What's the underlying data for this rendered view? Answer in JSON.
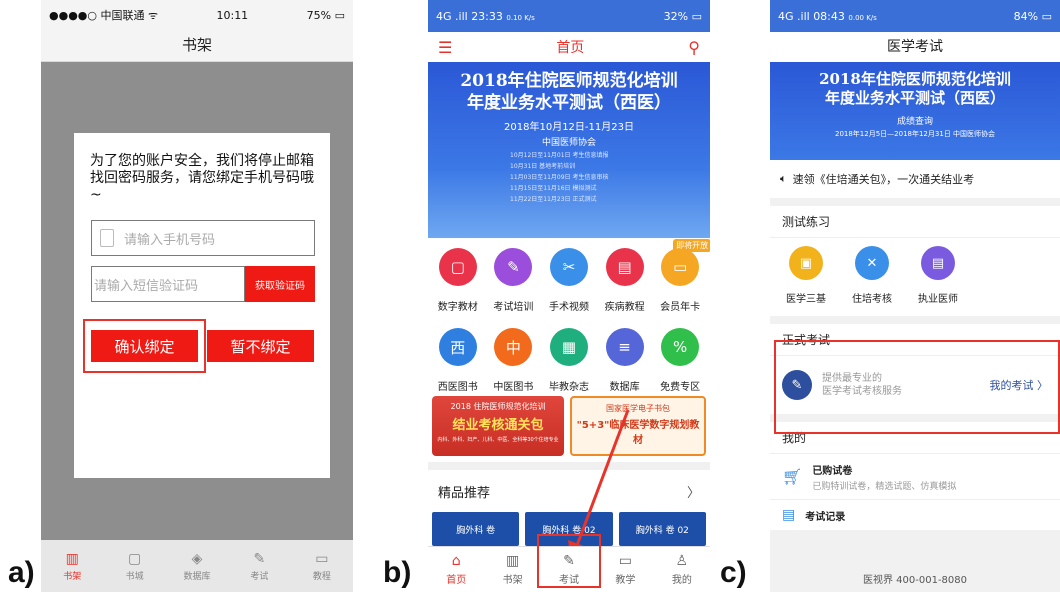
{
  "panel_labels": {
    "a": "a)",
    "b": "b)",
    "c": "c)"
  },
  "panel_a": {
    "status": {
      "carrier": "●●●●○ 中国联通 ᯤ",
      "time": "10:11",
      "battery": "75%"
    },
    "title": "书架",
    "dialog": {
      "message": "为了您的账户安全，我们将停止邮箱找回密码服务，请您绑定手机号码哦~",
      "phone_placeholder": "请输入手机号码",
      "sms_placeholder": "请输入短信验证码",
      "get_code_label": "获取验证码",
      "confirm_label": "确认绑定",
      "skip_label": "暂不绑定"
    },
    "tabs": [
      {
        "label": "书架",
        "icon": "bookshelf-icon"
      },
      {
        "label": "书城",
        "icon": "store-icon"
      },
      {
        "label": "数据库",
        "icon": "layers-icon"
      },
      {
        "label": "考试",
        "icon": "exam-icon"
      },
      {
        "label": "教程",
        "icon": "video-icon"
      }
    ]
  },
  "panel_b": {
    "status": {
      "network": "4G .ill",
      "time": "23:33",
      "speed": "0.10 K/s",
      "battery": "32%"
    },
    "title": "首页",
    "banner": {
      "title_line1": "2018年住院医师规范化培训",
      "title_line2": "年度业务水平测试（西医）",
      "dates": "2018年10月12日-11月23日",
      "org": "中国医师协会",
      "schedule": [
        "10月12日至11月01日  考生信息填报",
        "10月31日  基地考前培训",
        "11月03日至11月09日  考生信息审核",
        "11月15日至11月16日  模拟测试",
        "11月22日至11月23日  正式测试"
      ]
    },
    "grid": [
      {
        "label": "数字教材",
        "color": "#e8334a",
        "glyph": "▢"
      },
      {
        "label": "考试培训",
        "color": "#9b4ddb",
        "glyph": "✎"
      },
      {
        "label": "手术视频",
        "color": "#3a8fe8",
        "glyph": "✂"
      },
      {
        "label": "疾病教程",
        "color": "#e8334a",
        "glyph": "▤"
      },
      {
        "label": "会员年卡",
        "color": "#f5a623",
        "glyph": "▭"
      },
      {
        "label": "西医图书",
        "color": "#2f7fe0",
        "glyph": "西"
      },
      {
        "label": "中医图书",
        "color": "#f26a1b",
        "glyph": "中"
      },
      {
        "label": "毕教杂志",
        "color": "#1fae7d",
        "glyph": "▦"
      },
      {
        "label": "数据库",
        "color": "#5566d8",
        "glyph": "≡"
      },
      {
        "label": "免费专区",
        "color": "#2fbf4a",
        "glyph": "%"
      }
    ],
    "soon_badge": "即将开放",
    "promo1": {
      "line1": "2018 住院医师规范化培训",
      "line2": "结业考核通关包",
      "line3": "内科、外科、妇产、儿科、中医、全科等30个住培专业"
    },
    "promo2": {
      "line1": "国家医学电子书包",
      "line2": "\"5+3\"临床医学数字规划教材"
    },
    "section_title": "精品推荐",
    "thumbs": [
      "胸外科 卷",
      "胸外科 卷 02",
      "胸外科 卷 02"
    ],
    "tabs": [
      {
        "label": "首页",
        "icon": "home-icon"
      },
      {
        "label": "书架",
        "icon": "bookshelf-icon"
      },
      {
        "label": "考试",
        "icon": "exam-icon"
      },
      {
        "label": "教学",
        "icon": "teaching-icon"
      },
      {
        "label": "我的",
        "icon": "profile-icon"
      }
    ]
  },
  "panel_c": {
    "status": {
      "network": "4G .ill",
      "time": "08:43",
      "speed": "0.00 K/s",
      "battery": "84%"
    },
    "title": "医学考试",
    "banner": {
      "title_line1": "2018年住院医师规范化培训",
      "title_line2": "年度业务水平测试（西医）",
      "sub": "成绩查询",
      "dates": "2018年12月5日—2018年12月31日  中国医师协会"
    },
    "notice": "速领《住培通关包》，一次通关结业考",
    "practice_title": "测试练习",
    "practice": [
      {
        "label": "医学三基",
        "color": "#f2b21c",
        "glyph": "▣"
      },
      {
        "label": "住培考核",
        "color": "#3a8fe8",
        "glyph": "✕"
      },
      {
        "label": "执业医师",
        "color": "#7a5be0",
        "glyph": "▤"
      }
    ],
    "formal_title": "正式考试",
    "formal_desc_1": "提供最专业的",
    "formal_desc_2": "医学考试考核服务",
    "formal_link": "我的考试 〉",
    "mine_title": "我的",
    "mine_rows": [
      {
        "title": "已购试卷",
        "sub": "已购特训试卷，精选试题、仿真模拟"
      },
      {
        "title": "考试记录",
        "sub": ""
      }
    ],
    "footer": "医视界  400-001-8080"
  }
}
